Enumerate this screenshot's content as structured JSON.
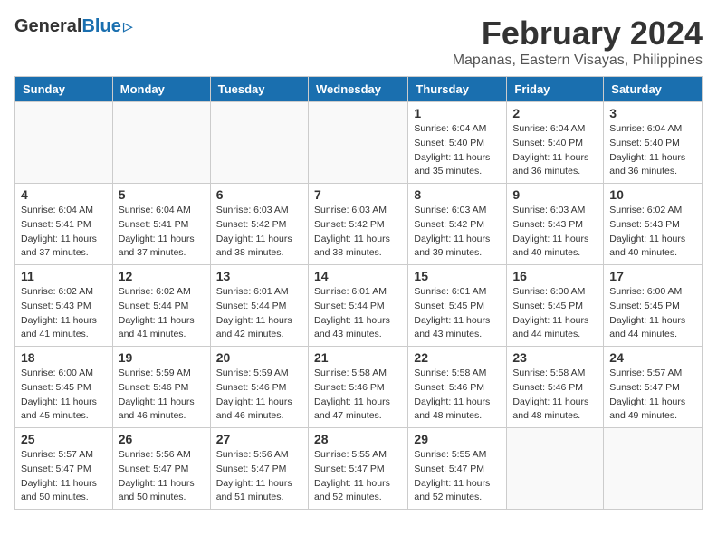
{
  "logo": {
    "general": "General",
    "blue": "Blue"
  },
  "title": {
    "month_year": "February 2024",
    "location": "Mapanas, Eastern Visayas, Philippines"
  },
  "days_of_week": [
    "Sunday",
    "Monday",
    "Tuesday",
    "Wednesday",
    "Thursday",
    "Friday",
    "Saturday"
  ],
  "weeks": [
    [
      {
        "day": "",
        "info": ""
      },
      {
        "day": "",
        "info": ""
      },
      {
        "day": "",
        "info": ""
      },
      {
        "day": "",
        "info": ""
      },
      {
        "day": "1",
        "info": "Sunrise: 6:04 AM\nSunset: 5:40 PM\nDaylight: 11 hours\nand 35 minutes."
      },
      {
        "day": "2",
        "info": "Sunrise: 6:04 AM\nSunset: 5:40 PM\nDaylight: 11 hours\nand 36 minutes."
      },
      {
        "day": "3",
        "info": "Sunrise: 6:04 AM\nSunset: 5:40 PM\nDaylight: 11 hours\nand 36 minutes."
      }
    ],
    [
      {
        "day": "4",
        "info": "Sunrise: 6:04 AM\nSunset: 5:41 PM\nDaylight: 11 hours\nand 37 minutes."
      },
      {
        "day": "5",
        "info": "Sunrise: 6:04 AM\nSunset: 5:41 PM\nDaylight: 11 hours\nand 37 minutes."
      },
      {
        "day": "6",
        "info": "Sunrise: 6:03 AM\nSunset: 5:42 PM\nDaylight: 11 hours\nand 38 minutes."
      },
      {
        "day": "7",
        "info": "Sunrise: 6:03 AM\nSunset: 5:42 PM\nDaylight: 11 hours\nand 38 minutes."
      },
      {
        "day": "8",
        "info": "Sunrise: 6:03 AM\nSunset: 5:42 PM\nDaylight: 11 hours\nand 39 minutes."
      },
      {
        "day": "9",
        "info": "Sunrise: 6:03 AM\nSunset: 5:43 PM\nDaylight: 11 hours\nand 40 minutes."
      },
      {
        "day": "10",
        "info": "Sunrise: 6:02 AM\nSunset: 5:43 PM\nDaylight: 11 hours\nand 40 minutes."
      }
    ],
    [
      {
        "day": "11",
        "info": "Sunrise: 6:02 AM\nSunset: 5:43 PM\nDaylight: 11 hours\nand 41 minutes."
      },
      {
        "day": "12",
        "info": "Sunrise: 6:02 AM\nSunset: 5:44 PM\nDaylight: 11 hours\nand 41 minutes."
      },
      {
        "day": "13",
        "info": "Sunrise: 6:01 AM\nSunset: 5:44 PM\nDaylight: 11 hours\nand 42 minutes."
      },
      {
        "day": "14",
        "info": "Sunrise: 6:01 AM\nSunset: 5:44 PM\nDaylight: 11 hours\nand 43 minutes."
      },
      {
        "day": "15",
        "info": "Sunrise: 6:01 AM\nSunset: 5:45 PM\nDaylight: 11 hours\nand 43 minutes."
      },
      {
        "day": "16",
        "info": "Sunrise: 6:00 AM\nSunset: 5:45 PM\nDaylight: 11 hours\nand 44 minutes."
      },
      {
        "day": "17",
        "info": "Sunrise: 6:00 AM\nSunset: 5:45 PM\nDaylight: 11 hours\nand 44 minutes."
      }
    ],
    [
      {
        "day": "18",
        "info": "Sunrise: 6:00 AM\nSunset: 5:45 PM\nDaylight: 11 hours\nand 45 minutes."
      },
      {
        "day": "19",
        "info": "Sunrise: 5:59 AM\nSunset: 5:46 PM\nDaylight: 11 hours\nand 46 minutes."
      },
      {
        "day": "20",
        "info": "Sunrise: 5:59 AM\nSunset: 5:46 PM\nDaylight: 11 hours\nand 46 minutes."
      },
      {
        "day": "21",
        "info": "Sunrise: 5:58 AM\nSunset: 5:46 PM\nDaylight: 11 hours\nand 47 minutes."
      },
      {
        "day": "22",
        "info": "Sunrise: 5:58 AM\nSunset: 5:46 PM\nDaylight: 11 hours\nand 48 minutes."
      },
      {
        "day": "23",
        "info": "Sunrise: 5:58 AM\nSunset: 5:46 PM\nDaylight: 11 hours\nand 48 minutes."
      },
      {
        "day": "24",
        "info": "Sunrise: 5:57 AM\nSunset: 5:47 PM\nDaylight: 11 hours\nand 49 minutes."
      }
    ],
    [
      {
        "day": "25",
        "info": "Sunrise: 5:57 AM\nSunset: 5:47 PM\nDaylight: 11 hours\nand 50 minutes."
      },
      {
        "day": "26",
        "info": "Sunrise: 5:56 AM\nSunset: 5:47 PM\nDaylight: 11 hours\nand 50 minutes."
      },
      {
        "day": "27",
        "info": "Sunrise: 5:56 AM\nSunset: 5:47 PM\nDaylight: 11 hours\nand 51 minutes."
      },
      {
        "day": "28",
        "info": "Sunrise: 5:55 AM\nSunset: 5:47 PM\nDaylight: 11 hours\nand 52 minutes."
      },
      {
        "day": "29",
        "info": "Sunrise: 5:55 AM\nSunset: 5:47 PM\nDaylight: 11 hours\nand 52 minutes."
      },
      {
        "day": "",
        "info": ""
      },
      {
        "day": "",
        "info": ""
      }
    ]
  ]
}
